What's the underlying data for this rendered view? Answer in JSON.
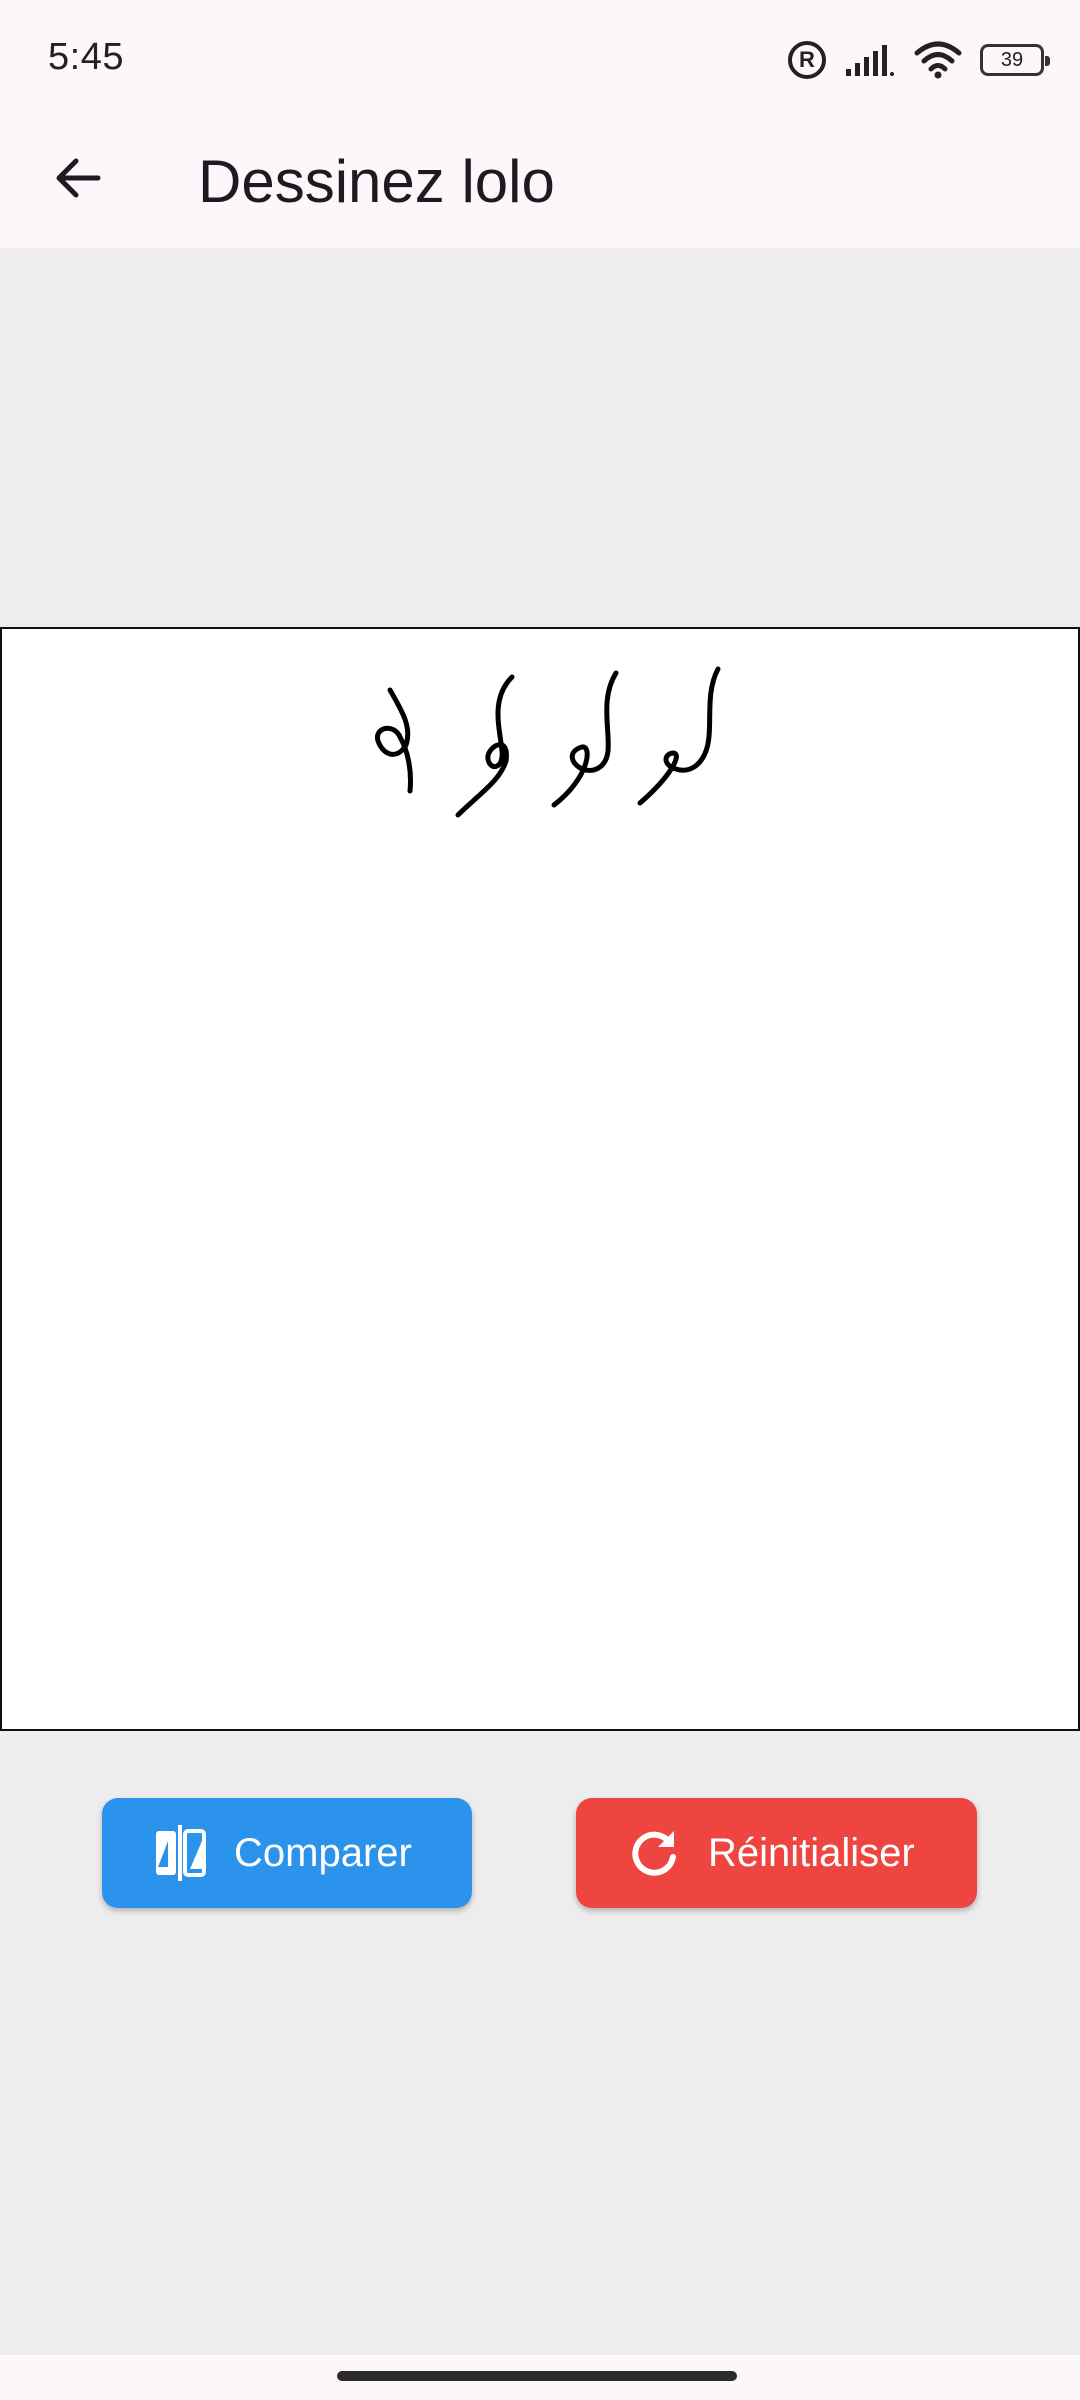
{
  "status_bar": {
    "time": "5:45",
    "registered_icon": "R",
    "battery_level": "39",
    "icons": [
      "registered-icon",
      "signal-icon",
      "wifi-icon",
      "battery-icon"
    ]
  },
  "app_bar": {
    "back_icon": "arrow-left-icon",
    "title": "Dessinez lolo"
  },
  "canvas": {
    "stroke_color": "#000000",
    "background": "#ffffff"
  },
  "actions": {
    "compare_label": "Comparer",
    "compare_icon": "compare-icon",
    "compare_color": "#2b93ec",
    "reset_label": "Réinitialiser",
    "reset_icon": "refresh-icon",
    "reset_color": "#ee4541"
  },
  "colors": {
    "app_bar_bg": "#fdf7fb",
    "page_bg": "#ededed"
  }
}
